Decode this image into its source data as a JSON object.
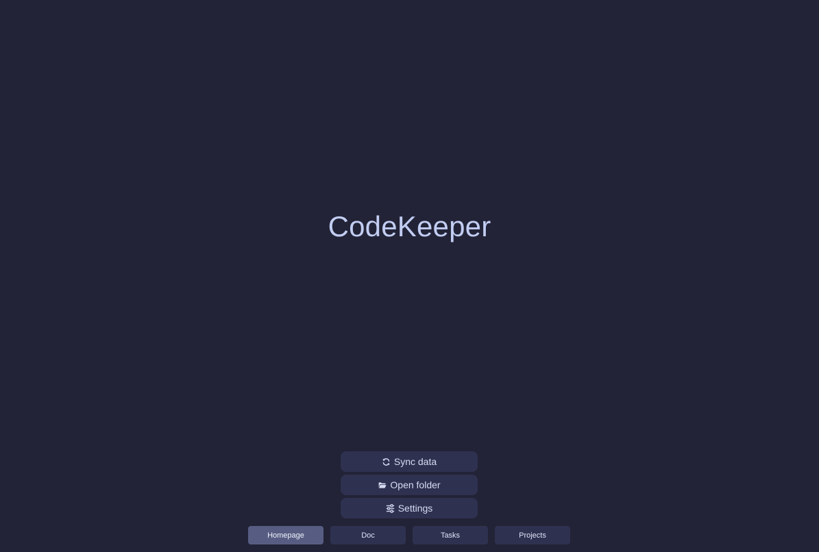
{
  "app": {
    "title": "CodeKeeper"
  },
  "actions": [
    {
      "label": "Sync data",
      "icon": "sync-icon"
    },
    {
      "label": "Open folder",
      "icon": "folder-open-icon"
    },
    {
      "label": "Settings",
      "icon": "sliders-icon"
    }
  ],
  "tabs": [
    {
      "label": "Homepage",
      "active": true
    },
    {
      "label": "Doc",
      "active": false
    },
    {
      "label": "Tasks",
      "active": false
    },
    {
      "label": "Projects",
      "active": false
    }
  ],
  "colors": {
    "background": "#222336",
    "button": "#2f3150",
    "active_tab": "#575d82",
    "title_text": "#c2cdf2"
  }
}
